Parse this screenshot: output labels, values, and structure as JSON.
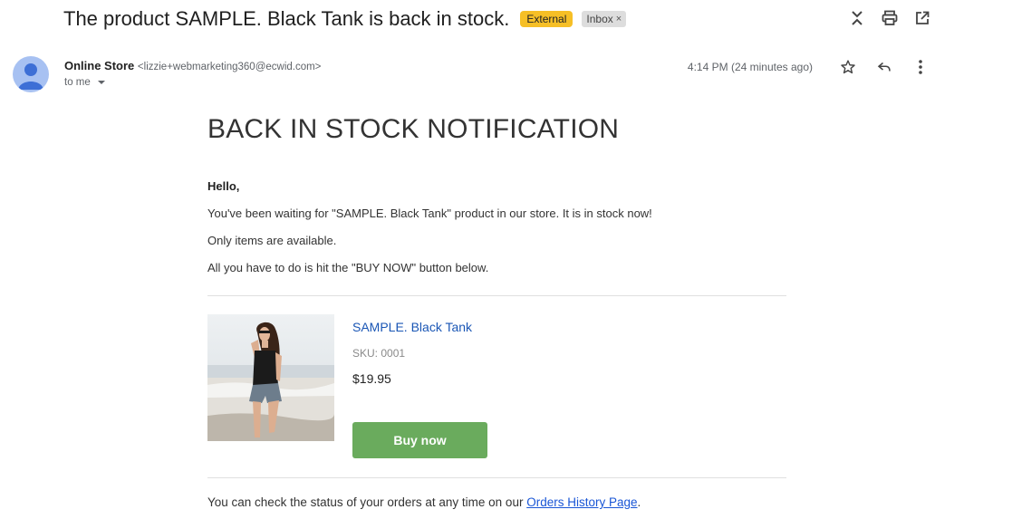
{
  "subject": {
    "title": "The product SAMPLE. Black Tank is back in stock.",
    "external_label": "External",
    "inbox_label": "Inbox",
    "inbox_remove": "×"
  },
  "toolbar": {
    "icons": [
      "expand-collapse-icon",
      "print-icon",
      "open-in-new-window-icon"
    ]
  },
  "sender": {
    "name": "Online Store",
    "email": "<lizzie+webmarketing360@ecwid.com>",
    "to": "to me",
    "timestamp": "4:14 PM (24 minutes ago)",
    "actions": [
      "star-icon",
      "reply-icon",
      "more-options-icon"
    ]
  },
  "email": {
    "headline": "BACK IN STOCK NOTIFICATION",
    "greeting": "Hello,",
    "paragraphs": [
      "You've been waiting for \"SAMPLE. Black Tank\" product in our store. It is in stock now!",
      "Only items are available.",
      "All you have to do is hit the \"BUY NOW\" button below."
    ],
    "product": {
      "name": "SAMPLE. Black Tank",
      "sku": "SKU: 0001",
      "price": "$19.95",
      "button_label": "Buy now"
    },
    "footer": {
      "text": "You can check the status of your orders at any time on our ",
      "link_text": "Orders History Page",
      "suffix": "."
    }
  },
  "colors": {
    "external_badge": "#f6bf26",
    "buy_button": "#6aab5d",
    "link": "#1a56d6",
    "avatar": "#a7c1f2"
  }
}
